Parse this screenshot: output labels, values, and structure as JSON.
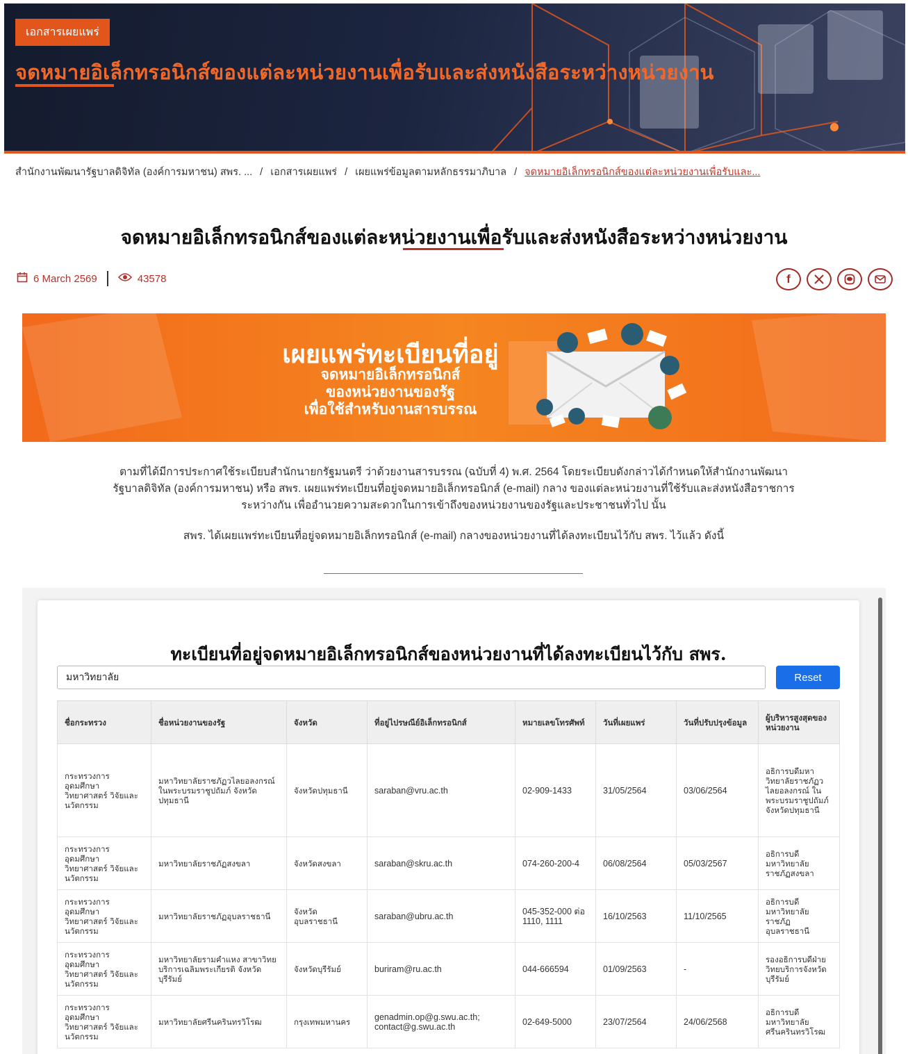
{
  "hero": {
    "tag": "เอกสารเผยแพร่",
    "title": "จดหมายอิเล็กทรอนิกส์ของแต่ละหน่วยงานเพื่อรับและส่งหนังสือระหว่างหน่วยงาน"
  },
  "breadcrumb": {
    "items": [
      "สำนักงานพัฒนารัฐบาลดิจิทัล (องค์การมหาชน) สพร. ...",
      "เอกสารเผยแพร่",
      "เผยแพร่ข้อมูลตามหลักธรรมาภิบาล"
    ],
    "current": "จดหมายอิเล็กทรอนิกส์ของแต่ละหน่วยงานเพื่อรับและ..."
  },
  "page_title": "จดหมายอิเล็กทรอนิกส์ของแต่ละหน่วยงานเพื่อรับและส่งหนังสือระหว่างหน่วยงาน",
  "meta": {
    "date": "6 March 2569",
    "views": "43578"
  },
  "banner": {
    "title": "เผยแพร่ทะเบียนที่อยู่",
    "line1": "จดหมายอิเล็กทรอนิกส์",
    "line2": "ของหน่วยงานของรัฐ",
    "line3": "เพื่อใช้สำหรับงานสารบรรณ"
  },
  "body": {
    "para1_l1": "ตามที่ได้มีการประกาศใช้ระเบียบสำนักนายกรัฐมนตรี ว่าด้วยงานสารบรรณ (ฉบับที่ 4) พ.ศ. 2564 โดยระเบียบดังกล่าวได้กำหนดให้สำนักงานพัฒนา",
    "para1_l2": "รัฐบาลดิจิทัล (องค์การมหาชน) หรือ สพร. เผยแพร่ทะเบียนที่อยู่จดหมายอิเล็กทรอนิกส์ (e-mail) กลาง ของแต่ละหน่วยงานที่ใช้รับและส่งหนังสือราชการ",
    "para1_l3": "ระหว่างกัน เพื่ออำนวยความสะดวกในการเข้าถึงของหน่วยงานของรัฐและประชาชนทั่วไป นั้น",
    "para2": "สพร. ได้เผยแพร่ทะเบียนที่อยู่จดหมายอิเล็กทรอนิกส์ (e-mail) กลางของหน่วยงานที่ได้ลงทะเบียนไว้กับ สพร. ไว้แล้ว ดังนี้"
  },
  "registry": {
    "title": "ทะเบียนที่อยู่จดหมายอิเล็กทรอนิกส์ของหน่วยงานที่ได้ลงทะเบียนไว้กับ สพร.",
    "search_value": "มหาวิทยาลัย",
    "reset_label": "Reset",
    "headers": [
      "ชื่อกระทรวง",
      "ชื่อหน่วยงานของรัฐ",
      "จังหวัด",
      "ที่อยู่ไปรษณีย์อิเล็กทรอนิกส์",
      "หมายเลขโทรศัพท์",
      "วันที่เผยแพร่",
      "วันที่ปรับปรุงข้อมูล",
      "ผู้บริหารสูงสุดของหน่วยงาน"
    ],
    "rows": [
      [
        "กระทรวงการอุดมศึกษา วิทยาศาสตร์ วิจัยและนวัตกรรม",
        "มหาวิทยาลัยราชภัฏวไลยอลงกรณ์ ในพระบรมราชูปถัมภ์ จังหวัดปทุมธานี",
        "จังหวัดปทุมธานี",
        "saraban@vru.ac.th",
        "02-909-1433",
        "31/05/2564",
        "03/06/2564",
        "อธิการบดีมหาวิทยาลัยราชภัฏวไลยอลงกรณ์ ในพระบรมราชูปถัมภ์ จังหวัดปทุมธานี"
      ],
      [
        "กระทรวงการอุดมศึกษา วิทยาศาสตร์ วิจัยและนวัตกรรม",
        "มหาวิทยาลัยราชภัฏสงขลา",
        "จังหวัดสงขลา",
        "saraban@skru.ac.th",
        "074-260-200-4",
        "06/08/2564",
        "05/03/2567",
        "อธิการบดีมหาวิทยาลัยราชภัฏสงขลา"
      ],
      [
        "กระทรวงการอุดมศึกษา วิทยาศาสตร์ วิจัยและนวัตกรรม",
        "มหาวิทยาลัยราชภัฏอุบลราชธานี",
        "จังหวัดอุบลราชธานี",
        "saraban@ubru.ac.th",
        "045-352-000 ต่อ 1110, 1111",
        "16/10/2563",
        "11/10/2565",
        "อธิการบดีมหาวิทยาลัยราชภัฏอุบลราชธานี"
      ],
      [
        "กระทรวงการอุดมศึกษา วิทยาศาสตร์ วิจัยและนวัตกรรม",
        "มหาวิทยาลัยรามคำแหง สาขาวิทยบริการเฉลิมพระเกียรติ จังหวัดบุรีรัมย์",
        "จังหวัดบุรีรัมย์",
        "buriram@ru.ac.th",
        "044-666594",
        "01/09/2563",
        "-",
        "รองอธิการบดีฝ่ายวิทยบริการจังหวัดบุรีรัมย์"
      ],
      [
        "กระทรวงการอุดมศึกษา วิทยาศาสตร์ วิจัยและนวัตกรรม",
        "มหาวิทยาลัยศรีนครินทรวิโรฒ",
        "กรุงเทพมหานคร",
        "genadmin.op@g.swu.ac.th; contact@g.swu.ac.th",
        "02-649-5000",
        "23/07/2564",
        "24/06/2568",
        "อธิการบดีมหาวิทยาลัยศรีนครินทรวิโรฒ"
      ]
    ]
  },
  "colors": {
    "brand_orange": "#e2561c",
    "accent_red": "#b8302b",
    "reset_blue": "#1a6fe8"
  },
  "icons": [
    "calendar-icon",
    "eye-icon",
    "facebook-icon",
    "x-icon",
    "line-icon",
    "email-icon"
  ]
}
